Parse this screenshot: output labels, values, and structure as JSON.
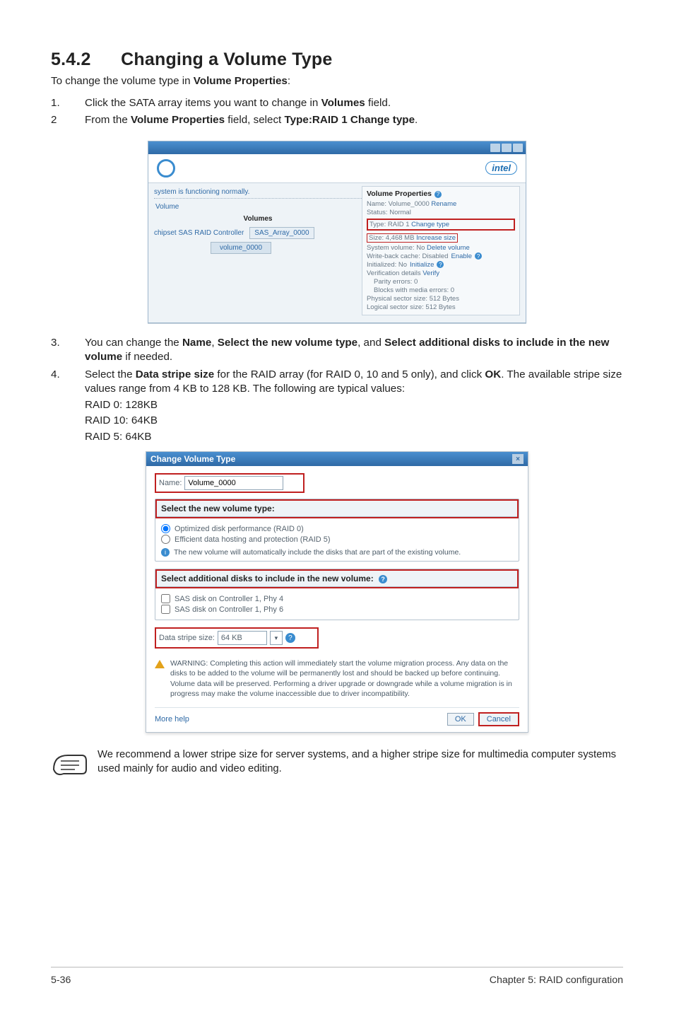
{
  "section": {
    "number": "5.4.2",
    "title": "Changing a Volume Type"
  },
  "intro": {
    "pre": "To change the volume type in ",
    "bold": "Volume Properties",
    "post": ":"
  },
  "steps": {
    "s1": {
      "num": "1.",
      "pre": "Click the SATA array items you want to change in ",
      "bold": "Volumes",
      "post": " field."
    },
    "s2": {
      "num": "2",
      "pre": "From the ",
      "bold1": "Volume Properties",
      "mid": " field, select ",
      "bold2": "Type:RAID 1 Change type",
      "post": "."
    },
    "s3": {
      "num": "3.",
      "pre": "You can change the ",
      "bold1": "Name",
      "mid1": ", ",
      "bold2": "Select the new volume type",
      "mid2": ", and ",
      "bold3": "Select additional disks to include in the new volume",
      "post": " if needed."
    },
    "s4": {
      "num": "4.",
      "pre": "Select the ",
      "bold1": "Data stripe size",
      "mid1": " for the RAID array (for RAID 0, 10 and 5 only), and click ",
      "bold2": "OK",
      "post": ". The available stripe size values range from 4 KB to 128 KB. The following are typical values:",
      "l1": "RAID 0: 128KB",
      "l2": "RAID 10: 64KB",
      "l3": "RAID 5: 64KB"
    }
  },
  "shot1": {
    "intel": "intel",
    "status_line": "system is functioning normally.",
    "volume_label": "Volume",
    "volumes_heading": "Volumes",
    "controller": "chipset SAS RAID Controller",
    "array_box": "SAS_Array_0000",
    "vol_box": "volume_0000",
    "props_title": "Volume Properties",
    "name": "Name: Volume_0000",
    "rename": "Rename",
    "status": "Status: Normal",
    "type_line": "Type: RAID 1",
    "change_type": "Change type",
    "size": "Size: 4,468 MB",
    "incr_size": "Increase size",
    "sys_vol": "System volume: No",
    "delete_vol": "Delete volume",
    "wb": "Write-back cache: Disabled",
    "enable": "Enable",
    "init": "Initialized: No",
    "initialize": "Initialize",
    "verif": "Verification details",
    "verify": "Verify",
    "parity": "Parity errors: 0",
    "blocks": "Blocks with media errors: 0",
    "phys": "Physical sector size: 512 Bytes",
    "logi": "Logical sector size: 512 Bytes"
  },
  "shot2": {
    "title": "Change Volume Type",
    "name_label": "Name:",
    "name_value": "Volume_0000",
    "panel1_head": "Select the new volume type:",
    "opt_raid0": "Optimized disk performance (RAID 0)",
    "opt_raid5": "Efficient data hosting and protection (RAID 5)",
    "panel1_note": "The new volume will automatically include the disks that are part of the existing volume.",
    "panel2_head": "Select additional disks to include in the new volume:",
    "disk1": "SAS disk on Controller 1, Phy 4",
    "disk2": "SAS disk on Controller 1, Phy 6",
    "stripe_label": "Data stripe size:",
    "stripe_value": "64 KB",
    "warning": "WARNING: Completing this action will immediately start the volume migration process. Any data on the disks to be added to the volume will be permanently lost and should be backed up before continuing. Volume data will be preserved. Performing a driver upgrade or downgrade while a volume migration is in progress may make the volume inaccessible due to driver incompatibility.",
    "more_help": "More help",
    "ok": "OK",
    "cancel": "Cancel"
  },
  "note": "We recommend a lower stripe size for server systems, and a higher stripe size for multimedia computer systems used mainly for audio and video editing.",
  "footer": {
    "left": "5-36",
    "right": "Chapter 5: RAID configuration"
  }
}
